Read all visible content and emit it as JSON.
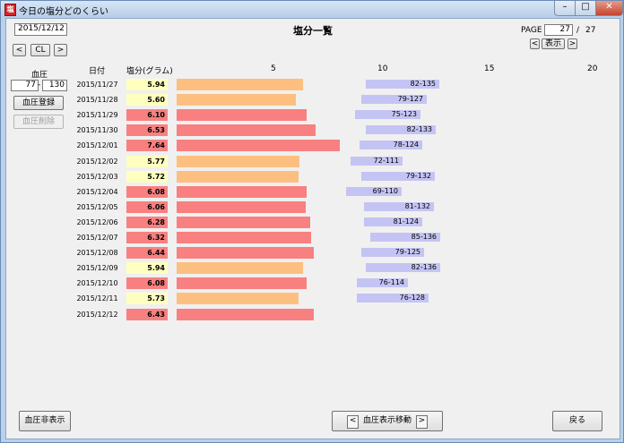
{
  "window": {
    "title": "今日の塩分どのくらい",
    "app_icon_glyph": "塩",
    "controls": {
      "minimize": "–",
      "maximize": "□",
      "close": "✕"
    }
  },
  "header": {
    "date_value": "2015/12/12",
    "prev_label": "<",
    "cl_label": "CL",
    "next_label": ">",
    "title": "塩分一覧",
    "page_label": "PAGE",
    "page_current": "27",
    "page_separator": "/",
    "page_total": "27",
    "page_prev_label": "<",
    "show_label": "表示",
    "page_next_label": ">"
  },
  "bp_panel": {
    "label": "血圧",
    "low_value": "77",
    "separator": "-",
    "high_value": "130",
    "register_label": "血圧登録",
    "delete_label": "血圧削除"
  },
  "columns": {
    "date": "日付",
    "salt": "塩分(グラム)"
  },
  "scale": {
    "ticks": [
      "5",
      "10",
      "15",
      "20"
    ],
    "tick_values": [
      5,
      10,
      15,
      20
    ]
  },
  "colors": {
    "high": "#f88080",
    "mid": "#fcbf80",
    "low_value_bg": "#ffffc0",
    "bp": "#c4c4f4"
  },
  "rows": [
    {
      "date": "2015/11/27",
      "salt": "5.94",
      "salt_value": 5.94,
      "level": "mid",
      "bp": "82-135",
      "bp_low": 82,
      "bp_high": 135
    },
    {
      "date": "2015/11/28",
      "salt": "5.60",
      "salt_value": 5.6,
      "level": "mid",
      "bp": "79-127",
      "bp_low": 79,
      "bp_high": 127
    },
    {
      "date": "2015/11/29",
      "salt": "6.10",
      "salt_value": 6.1,
      "level": "high",
      "bp": "75-123",
      "bp_low": 75,
      "bp_high": 123
    },
    {
      "date": "2015/11/30",
      "salt": "6.53",
      "salt_value": 6.53,
      "level": "high",
      "bp": "82-133",
      "bp_low": 82,
      "bp_high": 133
    },
    {
      "date": "2015/12/01",
      "salt": "7.64",
      "salt_value": 7.64,
      "level": "high",
      "bp": "78-124",
      "bp_low": 78,
      "bp_high": 124
    },
    {
      "date": "2015/12/02",
      "salt": "5.77",
      "salt_value": 5.77,
      "level": "mid",
      "bp": "72-111",
      "bp_low": 72,
      "bp_high": 111
    },
    {
      "date": "2015/12/03",
      "salt": "5.72",
      "salt_value": 5.72,
      "level": "mid",
      "bp": "79-132",
      "bp_low": 79,
      "bp_high": 132
    },
    {
      "date": "2015/12/04",
      "salt": "6.08",
      "salt_value": 6.08,
      "level": "high",
      "bp": "69-110",
      "bp_low": 69,
      "bp_high": 110
    },
    {
      "date": "2015/12/05",
      "salt": "6.06",
      "salt_value": 6.06,
      "level": "high",
      "bp": "81-132",
      "bp_low": 81,
      "bp_high": 132
    },
    {
      "date": "2015/12/06",
      "salt": "6.28",
      "salt_value": 6.28,
      "level": "high",
      "bp": "81-124",
      "bp_low": 81,
      "bp_high": 124
    },
    {
      "date": "2015/12/07",
      "salt": "6.32",
      "salt_value": 6.32,
      "level": "high",
      "bp": "85-136",
      "bp_low": 85,
      "bp_high": 136
    },
    {
      "date": "2015/12/08",
      "salt": "6.44",
      "salt_value": 6.44,
      "level": "high",
      "bp": "79-125",
      "bp_low": 79,
      "bp_high": 125
    },
    {
      "date": "2015/12/09",
      "salt": "5.94",
      "salt_value": 5.94,
      "level": "mid",
      "bp": "82-136",
      "bp_low": 82,
      "bp_high": 136
    },
    {
      "date": "2015/12/10",
      "salt": "6.08",
      "salt_value": 6.08,
      "level": "high",
      "bp": "76-114",
      "bp_low": 76,
      "bp_high": 114
    },
    {
      "date": "2015/12/11",
      "salt": "5.73",
      "salt_value": 5.73,
      "level": "mid",
      "bp": "76-128",
      "bp_low": 76,
      "bp_high": 128
    },
    {
      "date": "2015/12/12",
      "salt": "6.43",
      "salt_value": 6.43,
      "level": "high",
      "bp": "",
      "bp_low": null,
      "bp_high": null
    }
  ],
  "footer": {
    "hide_bp_label": "血圧非表示",
    "bp_move_prev_label": "<",
    "bp_move_label": "血圧表示移動",
    "bp_move_next_label": ">",
    "back_label": "戻る"
  }
}
